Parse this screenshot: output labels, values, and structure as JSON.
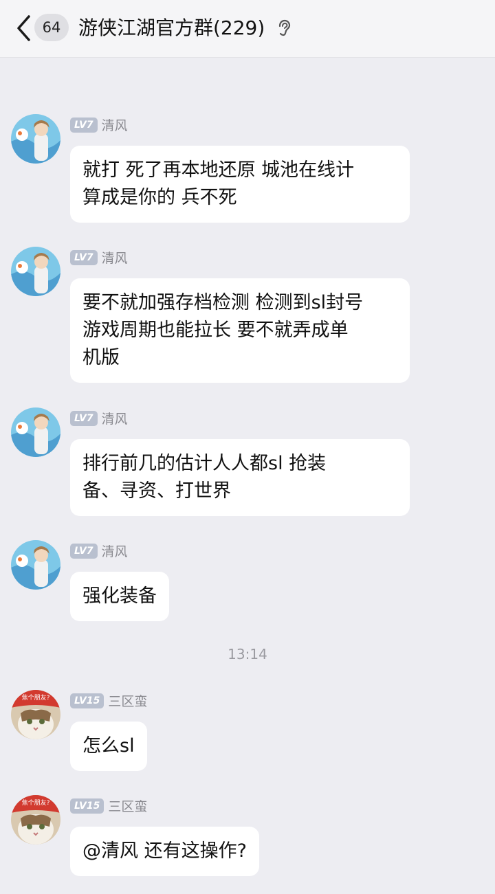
{
  "header": {
    "unread_count": "64",
    "title": "游侠江湖官方群(229)",
    "back_icon": "chevron-left-icon",
    "ear_icon": "ear-icon"
  },
  "timestamp": "13:14",
  "messages": [
    {
      "level": "LV7",
      "name": "清风",
      "lines": [
        "就打 死了再本地还原 城池在线计",
        "算成是你的  兵不死"
      ]
    },
    {
      "level": "LV7",
      "name": "清风",
      "lines": [
        "要不就加强存档检测 检测到sl封号",
        "游戏周期也能拉长  要不就弄成单",
        "机版"
      ]
    },
    {
      "level": "LV7",
      "name": "清风",
      "lines": [
        "排行前几的估计人人都sl  抢装",
        "备、寻资、打世界"
      ]
    },
    {
      "level": "LV7",
      "name": "清风",
      "lines": [
        "强化装备"
      ]
    },
    {
      "level": "LV15",
      "name": "三区蛮",
      "avatar_text": "焦个朋友?",
      "lines": [
        "怎么sl"
      ]
    },
    {
      "level": "LV15",
      "name": "三区蛮",
      "avatar_text": "焦个朋友?",
      "lines": [
        "@清风  还有这操作?"
      ]
    }
  ],
  "colors": {
    "background": "#ededf2",
    "bubble": "#ffffff",
    "level_badge": "#b9c0cf",
    "sender_name": "#8a8a90"
  }
}
